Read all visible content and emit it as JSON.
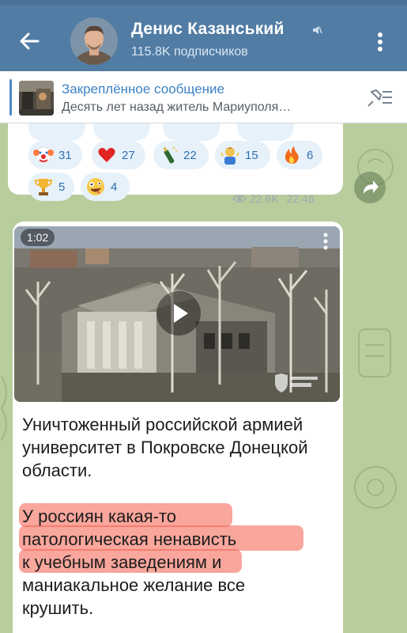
{
  "header": {
    "channel_name": "Денис Казанський",
    "subscribers": "115.8K подписчиков",
    "muted_icon": "mute-icon",
    "back_icon": "arrow-left-icon",
    "menu_icon": "more-vertical-icon",
    "bg_color": "#517ca4"
  },
  "pinned": {
    "title": "Закреплённое сообщение",
    "text": "Десять лет назад житель Мариуполя…",
    "unpin_icon": "unpin-icon"
  },
  "message1": {
    "reactions": [
      {
        "emoji": "clown",
        "count": "31"
      },
      {
        "emoji": "heart",
        "count": "27"
      },
      {
        "emoji": "champagne",
        "count": "22"
      },
      {
        "emoji": "shrug",
        "count": "15"
      },
      {
        "emoji": "fire",
        "count": "6"
      },
      {
        "emoji": "trophy",
        "count": "5"
      },
      {
        "emoji": "zany-face",
        "count": "4"
      }
    ],
    "views": "22.6K",
    "time": "22:46"
  },
  "message2": {
    "video_duration": "1:02",
    "paragraph1": "Уничтоженный российской армией университет в Покровске Донецкой области.",
    "paragraph2_lines": [
      "У россиян какая-то",
      "патологическая ненависть",
      "к учебным заведениям и",
      "маниакальное желание все",
      "крушить."
    ],
    "highlight_color": "#f45c4a"
  },
  "colors": {
    "accent": "#3c82c6",
    "chat_bg": "#b8cd9c",
    "reaction_bg": "#e7f1fa"
  }
}
